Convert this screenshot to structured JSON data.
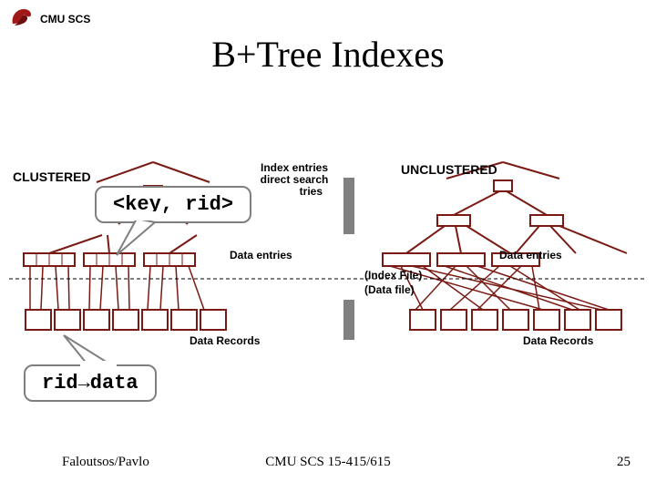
{
  "header": {
    "org": "CMU SCS"
  },
  "title": "B+Tree Indexes",
  "labels": {
    "clustered": "CLUSTERED",
    "unclustered": "UNCLUSTERED",
    "index_entries": "Index entries\ndirect search\n           tries",
    "data_entries_left": "Data entries",
    "data_entries_right": "Data entries",
    "index_file": "(Index File)",
    "data_file": "(Data file)",
    "data_records_left": "Data Records",
    "data_records_right": "Data Records"
  },
  "bubbles": {
    "key_rid": "<key, rid>",
    "rid_data": "rid→data"
  },
  "footer": {
    "left": "Faloutsos/Pavlo",
    "center": "CMU SCS 15-415/615",
    "right": "25"
  },
  "colors": {
    "brown": "#7a1a14",
    "grey": "#808080",
    "black": "#000000"
  }
}
